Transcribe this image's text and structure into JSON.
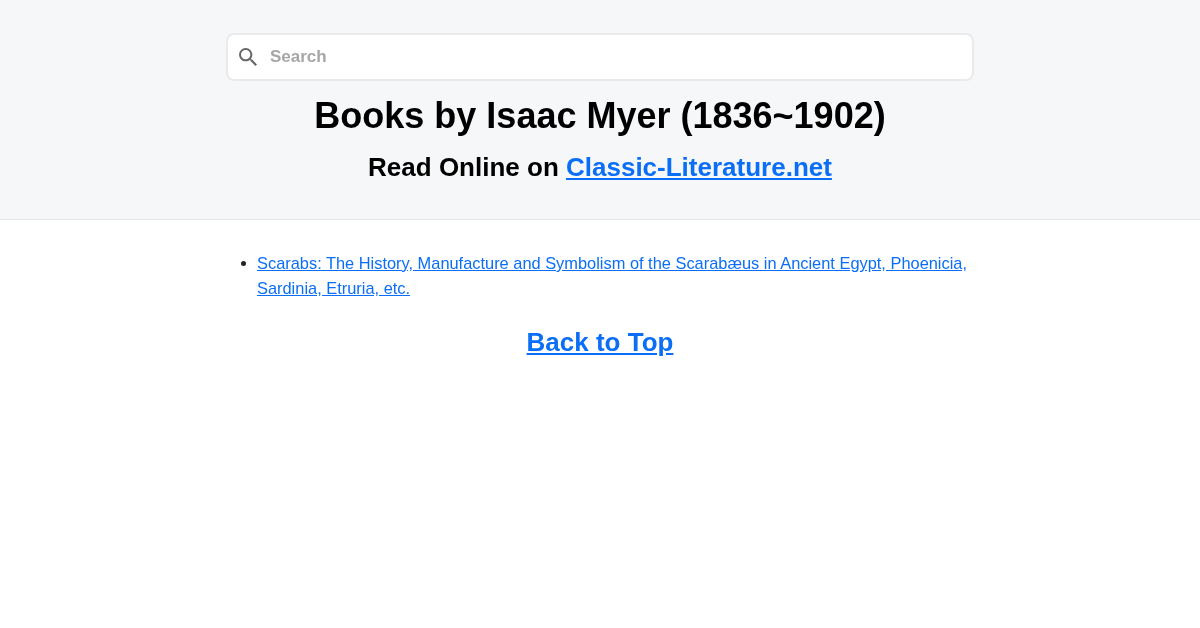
{
  "search": {
    "placeholder": "Search"
  },
  "header": {
    "title": "Books by Isaac Myer (1836~1902)",
    "subtitle": "Read Online on",
    "site_link": "Classic-Literature.net"
  },
  "books": [
    {
      "title": "Scarabs: The History, Manufacture and Symbolism of the Scarabæus in Ancient Egypt, Phoenicia, Sardinia, Etruria, etc."
    }
  ],
  "back_to_top": "Back to Top"
}
